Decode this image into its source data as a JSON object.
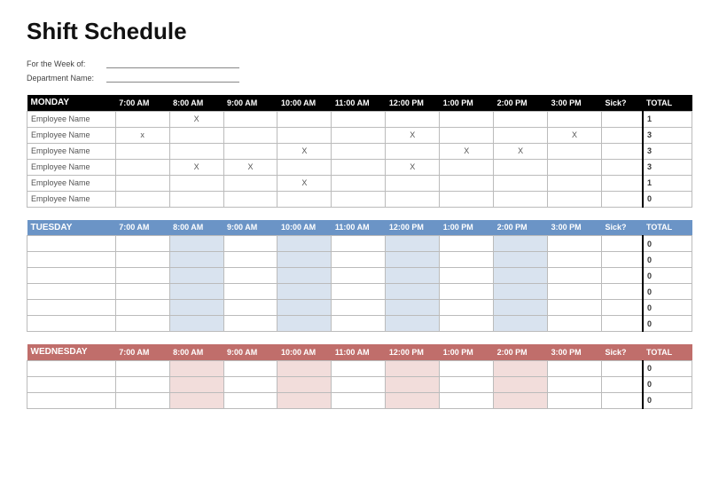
{
  "title": "Shift Schedule",
  "meta": {
    "week_label": "For the Week of:",
    "week_value": "",
    "dept_label": "Department Name:",
    "dept_value": ""
  },
  "columns": {
    "times": [
      "7:00 AM",
      "8:00 AM",
      "9:00 AM",
      "10:00 AM",
      "11:00 AM",
      "12:00 PM",
      "1:00 PM",
      "2:00 PM",
      "3:00 PM"
    ],
    "sick": "Sick?",
    "total": "TOTAL"
  },
  "blocks": [
    {
      "day": "MONDAY",
      "theme": "black",
      "stripe": "none",
      "rows": [
        {
          "name": "Employee Name",
          "marks": [
            "",
            "X",
            "",
            "",
            "",
            "",
            "",
            "",
            ""
          ],
          "sick": "",
          "total": "1"
        },
        {
          "name": "Employee Name",
          "marks": [
            "x",
            "",
            "",
            "",
            "",
            "X",
            "",
            "",
            "X"
          ],
          "sick": "",
          "total": "3"
        },
        {
          "name": "Employee Name",
          "marks": [
            "",
            "",
            "",
            "X",
            "",
            "",
            "X",
            "X",
            ""
          ],
          "sick": "",
          "total": "3"
        },
        {
          "name": "Employee Name",
          "marks": [
            "",
            "X",
            "X",
            "",
            "",
            "X",
            "",
            "",
            ""
          ],
          "sick": "",
          "total": "3"
        },
        {
          "name": "Employee Name",
          "marks": [
            "",
            "",
            "",
            "X",
            "",
            "",
            "",
            "",
            ""
          ],
          "sick": "",
          "total": "1"
        },
        {
          "name": "Employee Name",
          "marks": [
            "",
            "",
            "",
            "",
            "",
            "",
            "",
            "",
            ""
          ],
          "sick": "",
          "total": "0"
        }
      ]
    },
    {
      "day": "TUESDAY",
      "theme": "blue",
      "stripe": "blue",
      "rows": [
        {
          "name": "",
          "marks": [
            "",
            "",
            "",
            "",
            "",
            "",
            "",
            "",
            ""
          ],
          "sick": "",
          "total": "0"
        },
        {
          "name": "",
          "marks": [
            "",
            "",
            "",
            "",
            "",
            "",
            "",
            "",
            ""
          ],
          "sick": "",
          "total": "0"
        },
        {
          "name": "",
          "marks": [
            "",
            "",
            "",
            "",
            "",
            "",
            "",
            "",
            ""
          ],
          "sick": "",
          "total": "0"
        },
        {
          "name": "",
          "marks": [
            "",
            "",
            "",
            "",
            "",
            "",
            "",
            "",
            ""
          ],
          "sick": "",
          "total": "0"
        },
        {
          "name": "",
          "marks": [
            "",
            "",
            "",
            "",
            "",
            "",
            "",
            "",
            ""
          ],
          "sick": "",
          "total": "0"
        },
        {
          "name": "",
          "marks": [
            "",
            "",
            "",
            "",
            "",
            "",
            "",
            "",
            ""
          ],
          "sick": "",
          "total": "0"
        }
      ]
    },
    {
      "day": "WEDNESDAY",
      "theme": "red",
      "stripe": "red",
      "rows": [
        {
          "name": "",
          "marks": [
            "",
            "",
            "",
            "",
            "",
            "",
            "",
            "",
            ""
          ],
          "sick": "",
          "total": "0"
        },
        {
          "name": "",
          "marks": [
            "",
            "",
            "",
            "",
            "",
            "",
            "",
            "",
            ""
          ],
          "sick": "",
          "total": "0"
        },
        {
          "name": "",
          "marks": [
            "",
            "",
            "",
            "",
            "",
            "",
            "",
            "",
            ""
          ],
          "sick": "",
          "total": "0"
        }
      ]
    }
  ],
  "chart_data": {
    "type": "table",
    "title": "Shift Schedule",
    "time_slots": [
      "7:00 AM",
      "8:00 AM",
      "9:00 AM",
      "10:00 AM",
      "11:00 AM",
      "12:00 PM",
      "1:00 PM",
      "2:00 PM",
      "3:00 PM"
    ],
    "days": [
      {
        "day": "MONDAY",
        "employees": [
          {
            "name": "Employee Name",
            "shifts": {
              "8:00 AM": true
            },
            "total": 1
          },
          {
            "name": "Employee Name",
            "shifts": {
              "7:00 AM": true,
              "12:00 PM": true,
              "3:00 PM": true
            },
            "total": 3
          },
          {
            "name": "Employee Name",
            "shifts": {
              "10:00 AM": true,
              "1:00 PM": true,
              "2:00 PM": true
            },
            "total": 3
          },
          {
            "name": "Employee Name",
            "shifts": {
              "8:00 AM": true,
              "9:00 AM": true,
              "12:00 PM": true
            },
            "total": 3
          },
          {
            "name": "Employee Name",
            "shifts": {
              "10:00 AM": true
            },
            "total": 1
          },
          {
            "name": "Employee Name",
            "shifts": {},
            "total": 0
          }
        ]
      },
      {
        "day": "TUESDAY",
        "employees": [
          {
            "name": "",
            "shifts": {},
            "total": 0
          },
          {
            "name": "",
            "shifts": {},
            "total": 0
          },
          {
            "name": "",
            "shifts": {},
            "total": 0
          },
          {
            "name": "",
            "shifts": {},
            "total": 0
          },
          {
            "name": "",
            "shifts": {},
            "total": 0
          },
          {
            "name": "",
            "shifts": {},
            "total": 0
          }
        ]
      },
      {
        "day": "WEDNESDAY",
        "employees": [
          {
            "name": "",
            "shifts": {},
            "total": 0
          },
          {
            "name": "",
            "shifts": {},
            "total": 0
          },
          {
            "name": "",
            "shifts": {},
            "total": 0
          }
        ]
      }
    ]
  }
}
